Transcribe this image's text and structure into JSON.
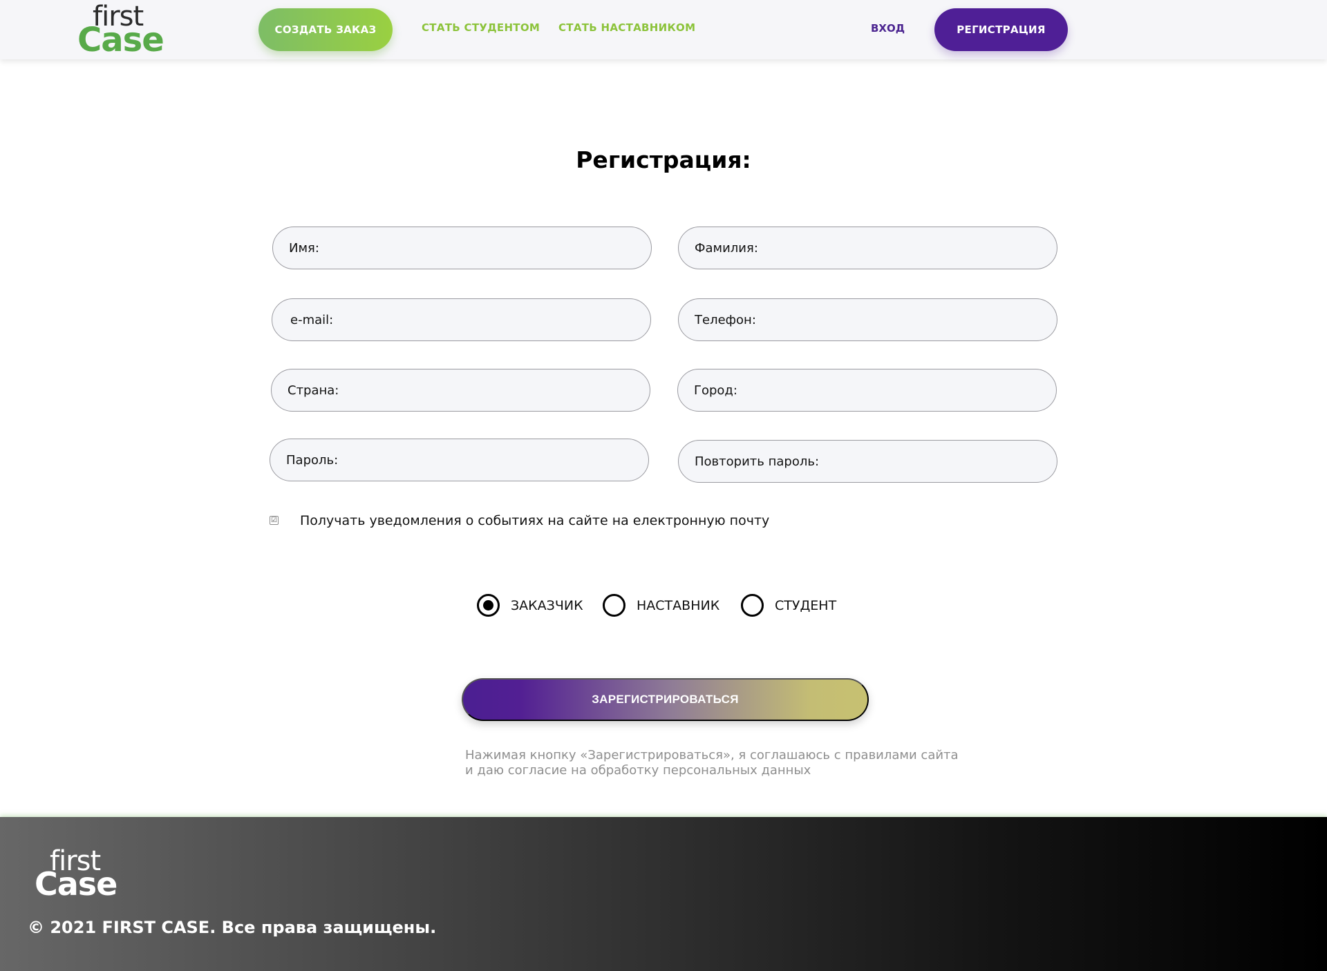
{
  "header": {
    "logo_top": "first",
    "logo_bottom": "Case",
    "create_order_label": "СОЗДАТЬ ЗАКАЗ",
    "become_student_label": "СТАТЬ СТУДЕНТОМ",
    "become_mentor_label": "СТАТЬ НАСТАВНИКОМ",
    "login_label": "ВХОД",
    "register_label": "РЕГИСТРАЦИЯ"
  },
  "form": {
    "title": "Регистрация:",
    "fields": {
      "first_name": {
        "placeholder": "Имя:",
        "value": ""
      },
      "last_name": {
        "placeholder": "Фамилия:",
        "value": ""
      },
      "email": {
        "placeholder": "e-mail:",
        "value": ""
      },
      "phone": {
        "placeholder": "Телефон:",
        "value": ""
      },
      "country": {
        "placeholder": "Страна:",
        "value": ""
      },
      "city": {
        "placeholder": "Город:",
        "value": ""
      },
      "password": {
        "placeholder": "Пароль:",
        "value": ""
      },
      "repeat_password": {
        "placeholder": "Повторить пароль:",
        "value": ""
      }
    },
    "notify": {
      "label": "Получать уведомления о событиях на сайте на електронную почту",
      "checked": true,
      "check_glyph": "☑"
    },
    "roles": {
      "options": [
        "ЗАКАЗЧИК",
        "НАСТАВНИК",
        "СТУДЕНТ"
      ],
      "selected": "ЗАКАЗЧИК"
    },
    "submit_label": "ЗАРЕГИСТРИРОВАТЬСЯ",
    "consent_line1": "Нажимая кнопку «Зарегистрироваться», я соглашаюсь с правилами сайта",
    "consent_line2": "и даю согласие на обработку персональных данных"
  },
  "footer": {
    "logo_top": "first",
    "logo_bottom": "Case",
    "copyright": "© 2021 FIRST CASE. Все права защищены."
  },
  "colors": {
    "brand_green": "#58aa49",
    "accent_green": "#8cc33b",
    "brand_purple": "#4f1f96",
    "muted_text": "#8e8e8e"
  }
}
